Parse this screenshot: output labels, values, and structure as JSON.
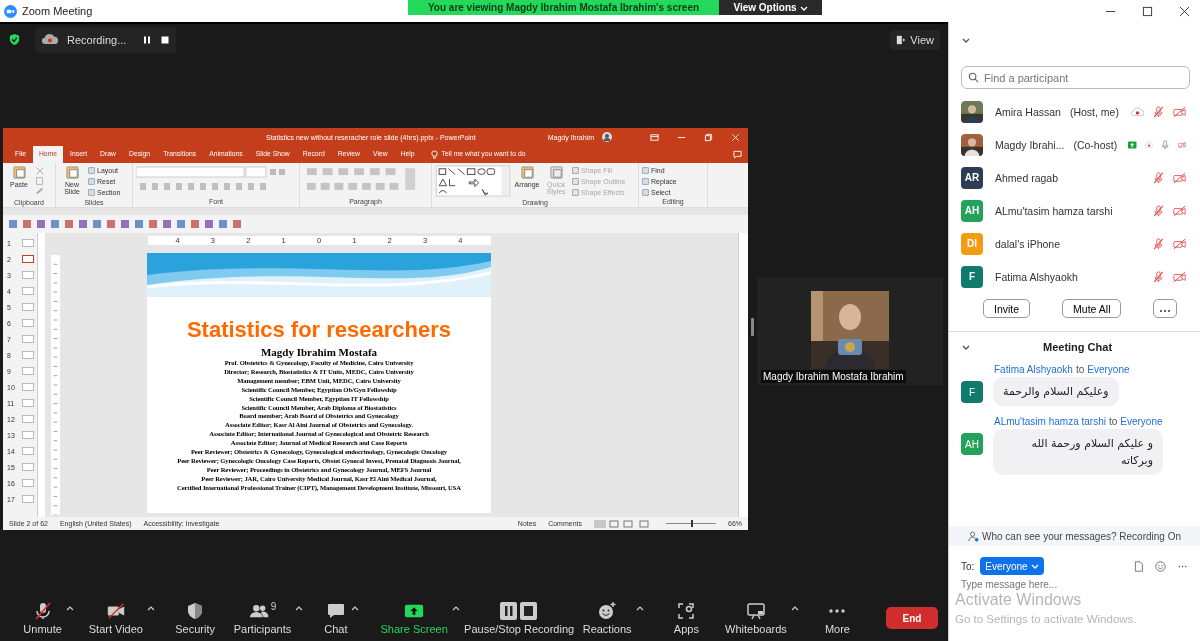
{
  "window": {
    "title": "Zoom Meeting"
  },
  "share_banner": {
    "text": "You are viewing Magdy Ibrahim Mostafa Ibrahim's screen",
    "button": "View Options"
  },
  "top_bar": {
    "recording_label": "Recording...",
    "view_button": "View"
  },
  "powerpoint": {
    "title": "Statistics new without reseracher role slide (4hrs).pptx  -  PowerPoint",
    "user": "Magdy Ibrahim",
    "tabs": [
      {
        "label": "File",
        "selected": false
      },
      {
        "label": "Home",
        "selected": true
      },
      {
        "label": "Insert",
        "selected": false
      },
      {
        "label": "Draw",
        "selected": false
      },
      {
        "label": "Design",
        "selected": false
      },
      {
        "label": "Transitions",
        "selected": false
      },
      {
        "label": "Animations",
        "selected": false
      },
      {
        "label": "Slide Show",
        "selected": false
      },
      {
        "label": "Record",
        "selected": false
      },
      {
        "label": "Review",
        "selected": false
      },
      {
        "label": "View",
        "selected": false
      },
      {
        "label": "Help",
        "selected": false
      }
    ],
    "tell_me": "Tell me what you want to do",
    "ribbon_groups": [
      {
        "label": "Clipboard",
        "items": [
          {
            "kind": "large",
            "label": "Paste",
            "disabled": false
          },
          {
            "kind": "clip-tools"
          }
        ]
      },
      {
        "label": "Slides",
        "items": [
          {
            "kind": "large",
            "label": "New Slide",
            "disabled": false
          },
          {
            "kind": "small",
            "label": "Layout",
            "disabled": false
          },
          {
            "kind": "small",
            "label": "Reset",
            "disabled": false
          },
          {
            "kind": "small",
            "label": "Section",
            "disabled": false
          }
        ]
      },
      {
        "label": "Font",
        "items": [
          {
            "kind": "font-controls"
          }
        ]
      },
      {
        "label": "Paragraph",
        "items": [
          {
            "kind": "paragraph-controls"
          }
        ]
      },
      {
        "label": "Drawing",
        "items": [
          {
            "kind": "shapes"
          },
          {
            "kind": "large",
            "label": "Arrange",
            "disabled": false
          },
          {
            "kind": "large",
            "label": "Quick Styles",
            "disabled": true
          },
          {
            "kind": "small",
            "label": "Shape Fill",
            "disabled": true
          },
          {
            "kind": "small",
            "label": "Shape Outline",
            "disabled": true
          },
          {
            "kind": "small",
            "label": "Shape Effects",
            "disabled": true
          }
        ]
      },
      {
        "label": "Editing",
        "items": [
          {
            "kind": "small",
            "label": "Find",
            "disabled": false
          },
          {
            "kind": "small",
            "label": "Replace",
            "disabled": false
          },
          {
            "kind": "small",
            "label": "Select",
            "disabled": false
          }
        ]
      }
    ],
    "ruler_marks": [
      "4",
      "3",
      "2",
      "1",
      "0",
      "1",
      "2",
      "3",
      "4"
    ],
    "slides": [
      {
        "number": "1",
        "selected": false
      },
      {
        "number": "2",
        "selected": true
      },
      {
        "number": "3",
        "selected": false
      },
      {
        "number": "4",
        "selected": false
      },
      {
        "number": "5",
        "selected": false
      },
      {
        "number": "6",
        "selected": false
      },
      {
        "number": "7",
        "selected": false
      },
      {
        "number": "8",
        "selected": false
      },
      {
        "number": "9",
        "selected": false
      },
      {
        "number": "10",
        "selected": false
      },
      {
        "number": "11",
        "selected": false
      },
      {
        "number": "12",
        "selected": false
      },
      {
        "number": "13",
        "selected": false
      },
      {
        "number": "14",
        "selected": false
      },
      {
        "number": "15",
        "selected": false
      },
      {
        "number": "16",
        "selected": false
      },
      {
        "number": "17",
        "selected": false
      }
    ],
    "slide": {
      "title": "Statistics for researchers",
      "author": "Magdy Ibrahim Mostafa",
      "lines": [
        "Prof. Obstetrics & Gynecology, Faculty of Medicine, Cairo University",
        "Director; Research, Biostatistics & IT Units, MEDC, Cairo University",
        "Management member; EBM Unit, MEDC, Cairo University",
        "Scientific Council Member, Egyptian Ob/Gyn Fellowship",
        "Scientific Council Member, Egyptian IT Fellowship",
        "Scientific Council Member, Arab Diploma of Biostatistics",
        "Board member; Arab Board of Obstetrics and Gynecology",
        "Associate Editor; Kasr Al Aini Journal of Obstetrics and Gynecology.",
        "Associate Editor; International Journal of Gynecological and Obstetric Research",
        "Associate Editor; Journal of Medical Research and Case Reports",
        "Peer Reviewer; Obstetrics & Gynecology, Gynecological endocrinology, Gynecologic Oncology",
        "Peer Reviewer; Gynecologic Oncology Case Reports, Obstet Gynecol Invest, Prenatal Diagnosis Journal,",
        "Peer Reviewer; Proceedings in Obstetrics and Gynecology Journal, MEFS Journal",
        "Peer Reviewer; JAR, Cairo University Medical Journal, Kasr El Aini Medical Journal,",
        "Certified International Professional Trainer (CIPT), Management Development Institute, Missouri, USA"
      ]
    },
    "status_bar": {
      "slide_count": "Slide 2 of 62",
      "language": "English (United States)",
      "accessibility": "Accessibility: Investigate",
      "notes": "Notes",
      "comments": "Comments",
      "zoom": "66%",
      "zoom_level": {
        "level": 0.5
      }
    }
  },
  "video_tile": {
    "name": "Magdy Ibrahim Mostafa Ibrahim"
  },
  "participants": {
    "search": {
      "placeholder": "Find a participant"
    },
    "list": [
      {
        "name": "Amira Hassan",
        "role": "(Host, me)",
        "sharing": false,
        "recording": true,
        "muted": true,
        "video_off": true
      },
      {
        "name": "Magdy Ibrahi...",
        "role": "(Co-host)",
        "sharing": true,
        "recording": true,
        "muted": false,
        "video_off": true
      },
      {
        "name": "Ahmed ragab",
        "avatar": {
          "kind": "initials",
          "initials": "AR",
          "color": "#2c3e55"
        },
        "sharing": false,
        "recording": false,
        "muted": true,
        "video_off": true
      },
      {
        "name": "ALmu'tasim hamza tarshi",
        "avatar": {
          "kind": "initials",
          "initials": "AH",
          "color": "#23a35a"
        },
        "sharing": false,
        "recording": false,
        "muted": true,
        "video_off": true
      },
      {
        "name": "dalal's iPhone",
        "avatar": {
          "kind": "initials",
          "initials": "DI",
          "color": "#f39c12"
        },
        "sharing": false,
        "recording": false,
        "muted": true,
        "video_off": true
      },
      {
        "name": "Fatima Alshyaokh",
        "avatar": {
          "kind": "initials",
          "initials": "F",
          "color": "#0f7b6c"
        },
        "sharing": false,
        "recording": false,
        "muted": true,
        "video_off": true
      }
    ],
    "buttons": [
      "Invite",
      "Mute All"
    ]
  },
  "chat": {
    "title": "Meeting Chat",
    "messages": [
      {
        "sender": "Fatima Alshyaokh",
        "to": "to",
        "recipient": "Everyone",
        "text": "وعليكم السلام والرحمة",
        "avatar": {
          "initials": "F",
          "color": "#0f7b6c"
        }
      },
      {
        "sender": "ALmu'tasim hamza tarshi",
        "to": "to",
        "recipient": "Everyone",
        "text": "و عليكم السلام ورحمة الله وبركاته",
        "avatar": {
          "initials": "AH",
          "color": "#23a35a"
        }
      }
    ],
    "notice": "Who can see your messages? Recording On",
    "to_label": "To:",
    "recipient": "Everyone",
    "placeholder": "Type message here..."
  },
  "toolbar": {
    "items": [
      {
        "label": "Unmute",
        "kind": "mic",
        "caret": true,
        "highlighted": false
      },
      {
        "label": "Start Video",
        "kind": "video",
        "caret": true,
        "highlighted": false
      },
      {
        "label": "Security",
        "kind": "security",
        "caret": false,
        "highlighted": false
      },
      {
        "label": "Participants",
        "kind": "participants",
        "caret": true,
        "badge": "9",
        "highlighted": false
      },
      {
        "label": "Chat",
        "kind": "chat",
        "caret": true,
        "highlighted": false
      },
      {
        "label": "Share Screen",
        "kind": "share",
        "caret": true,
        "highlighted": true
      },
      {
        "label": "Pause/Stop Recording",
        "kind": "recording",
        "caret": false,
        "highlighted": false
      },
      {
        "label": "Reactions",
        "kind": "reactions",
        "caret": true,
        "highlighted": false
      },
      {
        "label": "Apps",
        "kind": "apps",
        "caret": false,
        "highlighted": false
      },
      {
        "label": "Whiteboards",
        "kind": "whiteboards",
        "caret": true,
        "highlighted": false
      },
      {
        "label": "More",
        "kind": "more",
        "caret": false,
        "highlighted": false
      }
    ],
    "end_button": "End"
  },
  "activation_notice": {
    "title": "Activate Windows",
    "subtitle": "Go to Settings to activate Windows."
  }
}
